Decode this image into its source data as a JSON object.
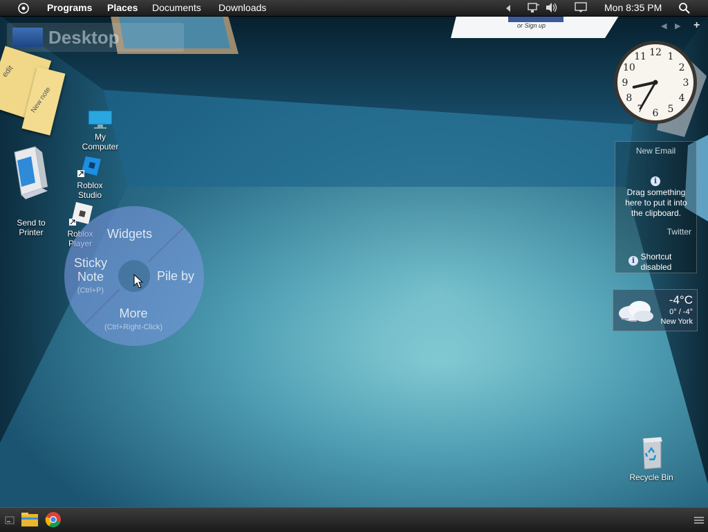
{
  "topbar": {
    "menus": [
      "Programs",
      "Places",
      "Documents",
      "Downloads"
    ],
    "clock": "Mon 8:35 PM"
  },
  "desktop": {
    "title": "Desktop",
    "sticky_notes": [
      "edit",
      "New note"
    ],
    "web_card_text": "or Sign up",
    "icons": {
      "my_computer": "My Computer",
      "roblox_studio": "Roblox Studio",
      "roblox_player": "Roblox Player",
      "send_to_printer": "Send to Printer",
      "recycle_bin": "Recycle Bin"
    }
  },
  "radial_menu": {
    "widgets": "Widgets",
    "sticky_note": "Sticky Note",
    "sticky_shortcut": "(Ctrl+P)",
    "pile_by": "Pile by",
    "more": "More",
    "more_shortcut": "(Ctrl+Right-Click)"
  },
  "clipboard_widget": {
    "new_email": "New Email",
    "drag_text": "Drag something here to put it into the clipboard.",
    "twitter": "Twitter",
    "shortcut_text": "Shortcut disabled",
    "info_glyph": "i"
  },
  "weather": {
    "temp": "-4°C",
    "range": "0° / -4°",
    "city": "New York"
  },
  "clock_widget": {
    "hour": 8,
    "minute": 35,
    "numerals": [
      "12",
      "1",
      "2",
      "3",
      "4",
      "5",
      "6",
      "7",
      "8",
      "9",
      "10",
      "11"
    ]
  }
}
